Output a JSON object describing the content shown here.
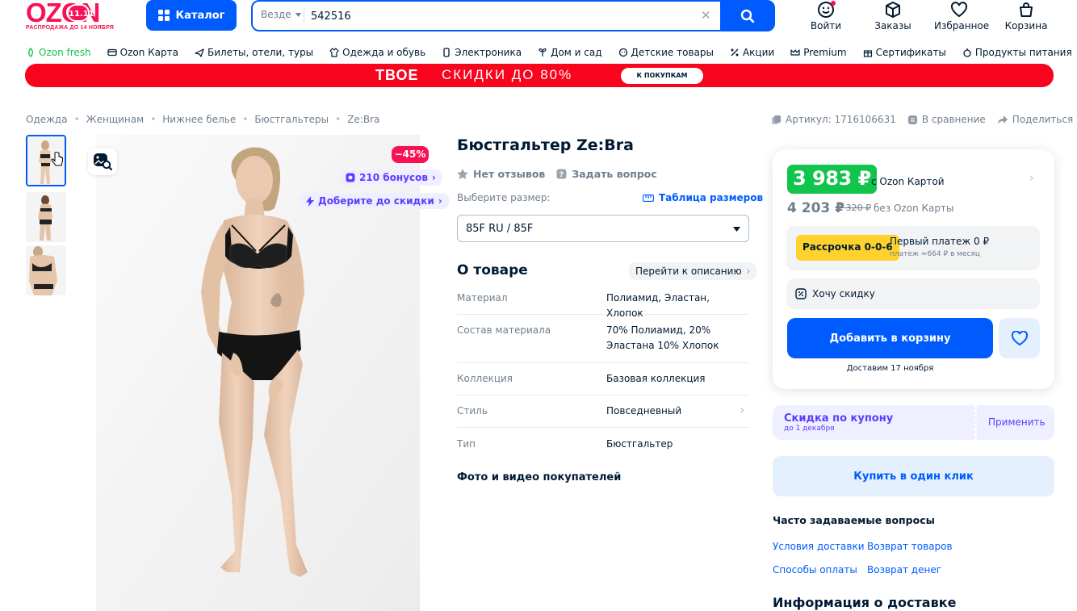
{
  "header": {
    "logo_text": "OZON",
    "logo_badge": "11.11",
    "logo_subtitle": "РАСПРОДАЖА ДО 14 НОЯБРЯ",
    "catalog_label": "Каталог",
    "search_scope": "Везде",
    "search_value": "542516",
    "actions": [
      {
        "label": "Войти",
        "icon": "user-smile-icon"
      },
      {
        "label": "Заказы",
        "icon": "box-icon"
      },
      {
        "label": "Избранное",
        "icon": "heart-icon"
      },
      {
        "label": "Корзина",
        "icon": "cart-icon"
      }
    ]
  },
  "nav": [
    {
      "label": "Ozon fresh",
      "icon": "fresh-icon"
    },
    {
      "label": "Ozon Карта",
      "icon": "card-icon"
    },
    {
      "label": "Билеты, отели, туры",
      "icon": "plane-icon"
    },
    {
      "label": "Одежда и обувь",
      "icon": "clothes-icon"
    },
    {
      "label": "Электроника",
      "icon": "phone-icon"
    },
    {
      "label": "Дом и сад",
      "icon": "plant-icon"
    },
    {
      "label": "Детские товары",
      "icon": "baby-icon"
    },
    {
      "label": "Акции",
      "icon": "percent-icon"
    },
    {
      "label": "Premium",
      "icon": "crown-icon"
    },
    {
      "label": "Сертификаты",
      "icon": "gift-icon"
    },
    {
      "label": "Продукты питания",
      "icon": "food-icon"
    }
  ],
  "banner": {
    "brand": "ТВОЕ",
    "text": "СКИДКИ ДО 80%",
    "cta": "К ПОКУПКАМ"
  },
  "breadcrumbs": [
    "Одежда",
    "Женщинам",
    "Нижнее белье",
    "Бюстгальтеры",
    "Ze:Bra"
  ],
  "meta": {
    "article": "Артикул: 1716106631",
    "compare": "В сравнение",
    "share": "Поделиться"
  },
  "gallery": {
    "discount": "−45%",
    "bonus": "210 бонусов",
    "more_discount": "Доберите до скидки"
  },
  "product": {
    "title": "Бюстгальтер Ze:Bra",
    "reviews": "Нет отзывов",
    "ask": "Задать вопрос",
    "size_label": "Выберите размер:",
    "size_table": "Таблица размеров",
    "size_value": "85F RU / 85F",
    "about_title": "О товаре",
    "goto_desc": "Перейти к описанию",
    "specs": [
      {
        "key": "Материал",
        "value": "Полиамид, Эластан, Хлопок"
      },
      {
        "key": "Состав материала",
        "value": "70% Полиамид, 20% Эластана 10% Хлопок"
      },
      {
        "key": "Коллекция",
        "value": "Базовая коллекция"
      },
      {
        "key": "Стиль",
        "value": "Повседневный"
      },
      {
        "key": "Тип",
        "value": "Бюстгальтер"
      }
    ],
    "buyer_media": "Фото и видео покупателей"
  },
  "buy": {
    "card_price": "3 983 ₽",
    "card_price_caption": "с Ozon Картой",
    "price": "4 203 ₽",
    "old_price": "7 320 ₽",
    "price_caption": "без Ozon Карты",
    "installment_badge": "Рассрочка 0-0-6",
    "installment_title": "Первый платеж 0 ₽",
    "installment_sub": "платеж ≈664 ₽ в месяц",
    "want_discount": "Хочу скидку",
    "add_to_cart": "Добавить в корзину",
    "delivery": "Доставим 17 ноября",
    "coupon_title": "Скидка по купону",
    "coupon_sub": "до 1 декабря",
    "coupon_apply": "Применить",
    "one_click": "Купить в один клик"
  },
  "faq": {
    "title": "Часто задаваемые вопросы",
    "links": [
      "Условия доставки",
      "Возврат товаров",
      "Способы оплаты",
      "Возврат денег"
    ]
  },
  "delivery_info_title": "Информация о доставке",
  "colors": {
    "brand_pink": "#f91155",
    "primary_blue": "#005bff",
    "green_price": "#10c44c",
    "bonus_purple": "#5f3bff",
    "banner_red": "#f8041d",
    "installment_yellow": "#ffd12c"
  }
}
